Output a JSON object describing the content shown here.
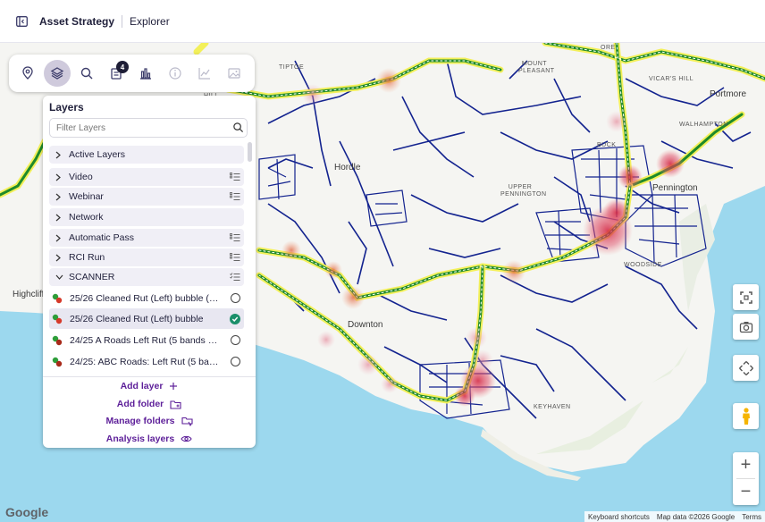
{
  "header": {
    "title": "Asset Strategy",
    "breadcrumb": "Explorer"
  },
  "toolbar": {
    "buttons": [
      {
        "icon": "map-pin-icon"
      },
      {
        "icon": "layers-icon",
        "active": true
      },
      {
        "icon": "search-icon"
      },
      {
        "icon": "report-icon",
        "badge": "4"
      },
      {
        "icon": "bar-chart-icon"
      },
      {
        "icon": "info-icon",
        "disabled": true
      },
      {
        "icon": "line-chart-icon",
        "disabled": true
      },
      {
        "icon": "image-icon",
        "disabled": true
      }
    ]
  },
  "layers": {
    "title": "Layers",
    "filter_placeholder": "Filter Layers",
    "groups": [
      {
        "label": "Active Layers",
        "list_icon": false
      },
      {
        "label": "Video",
        "list_icon": true
      },
      {
        "label": "Webinar",
        "list_icon": true
      },
      {
        "label": "Network",
        "list_icon": false
      },
      {
        "label": "Automatic Pass",
        "list_icon": true
      },
      {
        "label": "RCI Run",
        "list_icon": true
      },
      {
        "label": "SCANNER",
        "list_icon": true,
        "expanded": true
      }
    ],
    "items": [
      {
        "label": "25/26 Cleaned Rut (Left) bubble (…",
        "state": "unchecked"
      },
      {
        "label": "25/26 Cleaned Rut (Left) bubble",
        "state": "checked"
      },
      {
        "label": "24/25 A Roads Left Rut (5 bands …",
        "state": "unchecked"
      },
      {
        "label": "24/25: ABC Roads: Left Rut (5 ba…",
        "state": "unchecked"
      }
    ],
    "actions": [
      {
        "label": "Add layer",
        "icon": "plus-icon"
      },
      {
        "label": "Add folder",
        "icon": "folder-plus-icon"
      },
      {
        "label": "Manage folders",
        "icon": "manage-folders-icon"
      },
      {
        "label": "Analysis layers",
        "icon": "eye-icon"
      }
    ]
  },
  "map": {
    "places": [
      {
        "name": "TIPTOE"
      },
      {
        "name": "MOUNT PLEASANT"
      },
      {
        "name": "VICAR'S HILL"
      },
      {
        "name": "Pennington"
      },
      {
        "name": "Hordle"
      },
      {
        "name": "UPPER PENNINGTON"
      },
      {
        "name": "WALHAMPTON"
      },
      {
        "name": "Highcliffe"
      },
      {
        "name": "Downton"
      },
      {
        "name": "KEYHAVEN"
      },
      {
        "name": "WOODSIDE"
      },
      {
        "name": "Portmore"
      },
      {
        "name": "BUCK"
      },
      {
        "name": "ORE"
      },
      {
        "name": "HILL"
      }
    ],
    "attribution": {
      "shortcuts": "Keyboard shortcuts",
      "data": "Map data ©2026 Google",
      "terms": "Terms"
    },
    "logo": "Google"
  },
  "controls": {
    "zoom_in": "+",
    "zoom_out": "−"
  }
}
